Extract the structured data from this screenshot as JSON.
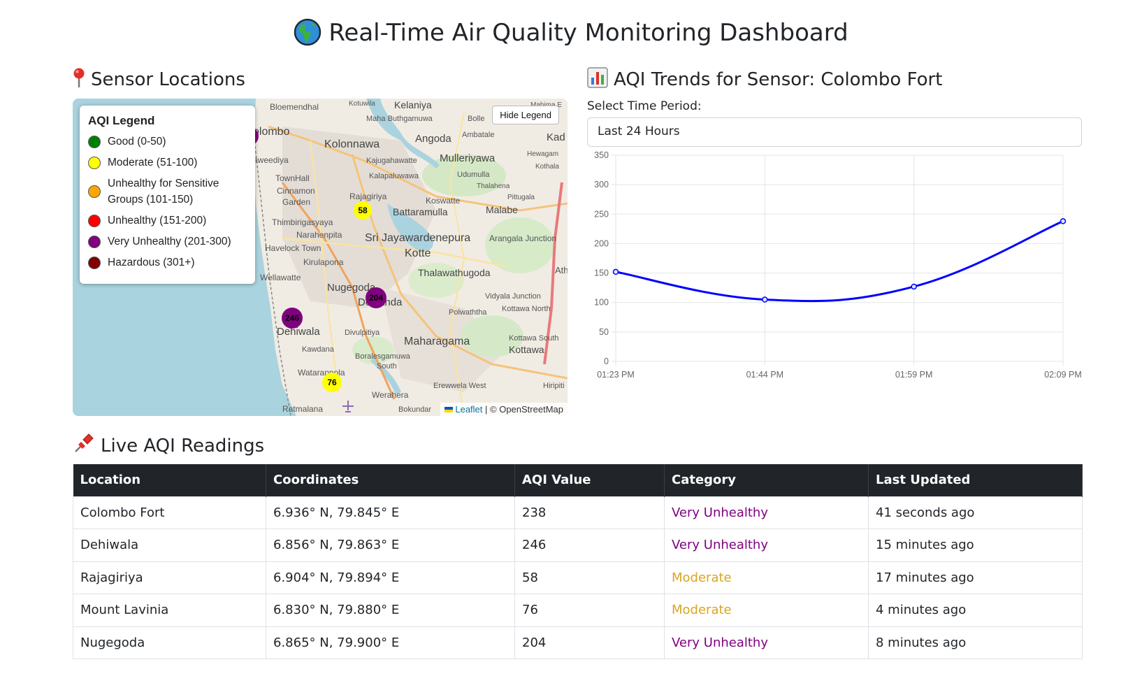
{
  "page": {
    "title": "Real-Time Air Quality Monitoring Dashboard",
    "title_icon": "globe-icon"
  },
  "map_section": {
    "heading": "Sensor Locations",
    "heading_icon": "round-pushpin-icon",
    "hide_legend_label": "Hide Legend",
    "attribution": {
      "leaflet": "Leaflet",
      "rest": "| © OpenStreetMap"
    },
    "legend": {
      "title": "AQI Legend",
      "items": [
        {
          "label": "Good (0-50)",
          "color": "#008000"
        },
        {
          "label": "Moderate (51-100)",
          "color": "#ffff00"
        },
        {
          "label": "Unhealthy for Sensitive Groups (101-150)",
          "color": "#ffa500"
        },
        {
          "label": "Unhealthy (151-200)",
          "color": "#ff0000"
        },
        {
          "label": "Very Unhealthy (201-300)",
          "color": "#800080"
        },
        {
          "label": "Hazardous (301+)",
          "color": "#800000"
        }
      ]
    },
    "markers": [
      {
        "label": "58",
        "color": "#ffff00"
      },
      {
        "label": "204",
        "color": "#800080"
      },
      {
        "label": "246",
        "color": "#800080"
      },
      {
        "label": "76",
        "color": "#ffff00"
      }
    ],
    "place_labels": [
      "Bloemendhal",
      "Kelaniya",
      "Kotuwila",
      "Mahima E",
      "Maha Buthgamuwa",
      "Bolle",
      "olombo",
      "Kolonnawa",
      "Angoda",
      "Ambatale",
      "Kad",
      "aweediya",
      "Kajugahawatte",
      "Mulleriyawa",
      "Hewagam",
      "Kothala",
      "TownHall",
      "Kalapaluwawa",
      "Udumulla",
      "Cinnamon",
      "Thalahena",
      "Garden",
      "Rajagiriya",
      "Koswatte",
      "Pittugala",
      "Battaramulla",
      "Malabe",
      "Thimbirigasyaya",
      "Narahenpita",
      "Sri Jayawardenepura",
      "Arangala Junction",
      "Havelock Town",
      "Kotte",
      "Kirulapona",
      "Thalawathugoda",
      "Ath",
      "Wellawatte",
      "Nugegoda",
      "Vidyala Junction",
      "Delkanda",
      "Polwaththa",
      "Kottawa North",
      "Dehiwala",
      "Divulpitiya",
      "Maharagama",
      "Kottawa South",
      "Kawdana",
      "Boralesgamuwa",
      "Kottawa",
      "South",
      "Watarappola",
      "Erewwela West",
      "Hiripiti",
      "Werahera",
      "Ratmalana",
      "Bokundar",
      "Ratmalana"
    ]
  },
  "trend_section": {
    "heading": "AQI Trends for Sensor: Colombo Fort",
    "heading_icon": "bar-chart-icon",
    "select_label": "Select Time Period:",
    "select_value": "Last 24 Hours"
  },
  "chart_data": {
    "type": "line",
    "x": [
      "01:23 PM",
      "01:44 PM",
      "01:59 PM",
      "02:09 PM"
    ],
    "series": [
      {
        "values": [
          152,
          105,
          127,
          238
        ],
        "color": "#0000ff"
      }
    ],
    "ylim": [
      0,
      350
    ],
    "yticks": [
      0,
      50,
      100,
      150,
      200,
      250,
      300,
      350
    ],
    "grid": true,
    "smooth": true
  },
  "table_section": {
    "heading": "Live AQI Readings",
    "heading_icon": "pushpin-icon",
    "columns": [
      "Location",
      "Coordinates",
      "AQI Value",
      "Category",
      "Last Updated"
    ],
    "rows": [
      {
        "location": "Colombo Fort",
        "coords": "6.936° N, 79.845° E",
        "aqi": "238",
        "category": "Very Unhealthy",
        "updated": "41 seconds ago"
      },
      {
        "location": "Dehiwala",
        "coords": "6.856° N, 79.863° E",
        "aqi": "246",
        "category": "Very Unhealthy",
        "updated": "15 minutes ago"
      },
      {
        "location": "Rajagiriya",
        "coords": "6.904° N, 79.894° E",
        "aqi": "58",
        "category": "Moderate",
        "updated": "17 minutes ago"
      },
      {
        "location": "Mount Lavinia",
        "coords": "6.830° N, 79.880° E",
        "aqi": "76",
        "category": "Moderate",
        "updated": "4 minutes ago"
      },
      {
        "location": "Nugegoda",
        "coords": "6.865° N, 79.900° E",
        "aqi": "204",
        "category": "Very Unhealthy",
        "updated": "8 minutes ago"
      }
    ]
  }
}
